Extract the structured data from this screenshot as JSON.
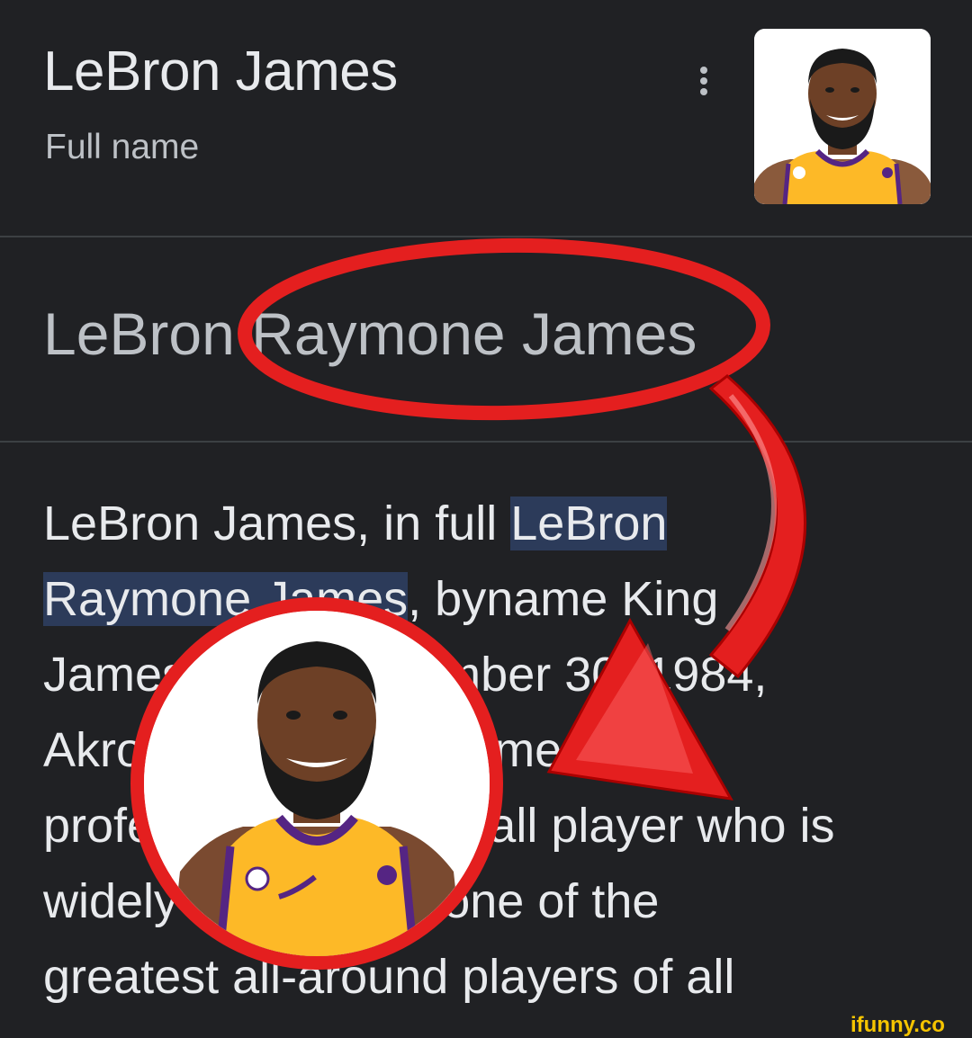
{
  "header": {
    "title": "LeBron James",
    "subtitle": "Full name"
  },
  "answer": {
    "prefix": "LeBron ",
    "circled": "Raymone James"
  },
  "description": {
    "lines": [
      {
        "plain": "LeBron James, in full ",
        "highlight": "LeBron"
      },
      {
        "highlight": "Raymone James",
        "plain": ", byname King"
      },
      {
        "plain": "James (born December 30, 1984,"
      },
      {
        "plain": "Akron, Ohio, U.S.), American"
      },
      {
        "plain": "professional basketball player who is"
      },
      {
        "plain": "widely considered one of the"
      },
      {
        "plain": "greatest all-around players of all"
      }
    ]
  },
  "watermark": "ifunny.co",
  "colors": {
    "background": "#202124",
    "annotation_red": "#e41f1f",
    "highlight": "#2c3b5a",
    "jersey_gold": "#fdb927",
    "jersey_purple": "#552583"
  },
  "icons": [
    "more-vert-icon",
    "player-photo",
    "red-circle-annotation",
    "red-arrow-annotation"
  ]
}
